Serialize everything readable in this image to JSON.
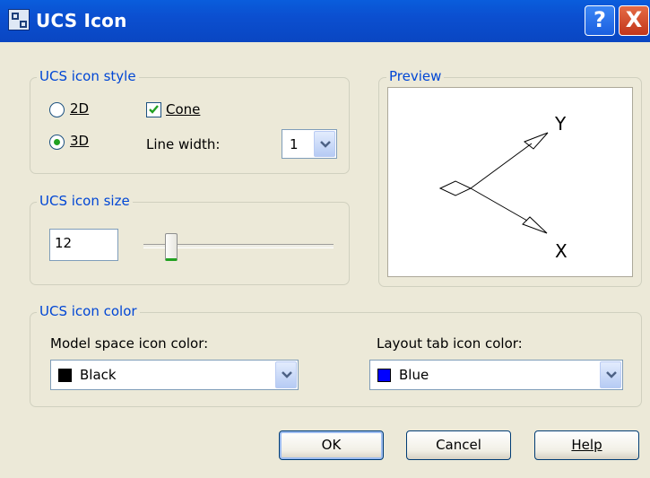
{
  "window": {
    "title": "UCS Icon",
    "help_glyph": "?",
    "close_glyph": "X"
  },
  "style_group": {
    "legend": "UCS icon style",
    "radio_2d": {
      "label": "2D",
      "selected": false
    },
    "radio_3d": {
      "label": "3D",
      "selected": true
    },
    "cone": {
      "label": "Cone",
      "checked": true
    },
    "line_width": {
      "label": "Line width:",
      "value": "1"
    }
  },
  "preview_group": {
    "legend": "Preview",
    "y_label": "Y",
    "x_label": "X"
  },
  "size_group": {
    "legend": "UCS icon size",
    "value": "12",
    "slider_fraction": 0.12
  },
  "color_group": {
    "legend": "UCS icon color",
    "model_label": "Model space icon color:",
    "model_value": "Black",
    "model_color": "#000000",
    "layout_label": "Layout tab icon color:",
    "layout_value": "Blue",
    "layout_color": "#0000ff"
  },
  "buttons": {
    "ok": "OK",
    "cancel": "Cancel",
    "help": "Help"
  }
}
